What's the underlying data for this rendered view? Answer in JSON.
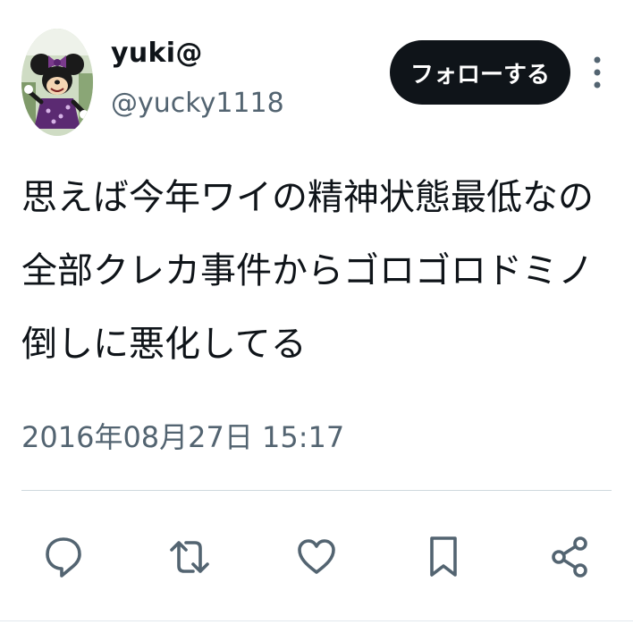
{
  "tweet": {
    "display_name": "yuki@",
    "handle": "@yucky1118",
    "follow_label": "フォローする",
    "text": "思えば今年ワイの精神状態最低なの全部クレカ事件からゴロゴロドミノ倒しに悪化してる",
    "timestamp": "2016年08月27日 15:17"
  },
  "icons": {
    "more": "more-vertical-icon",
    "reply": "reply-icon",
    "retweet": "retweet-icon",
    "like": "heart-icon",
    "bookmark": "bookmark-icon",
    "share": "share-icon"
  },
  "colors": {
    "text_primary": "#0f1419",
    "text_secondary": "#536471",
    "follow_button_bg": "#0f1419",
    "follow_button_text": "#ffffff",
    "divider": "#cfd9de",
    "icon_color": "#536471"
  }
}
